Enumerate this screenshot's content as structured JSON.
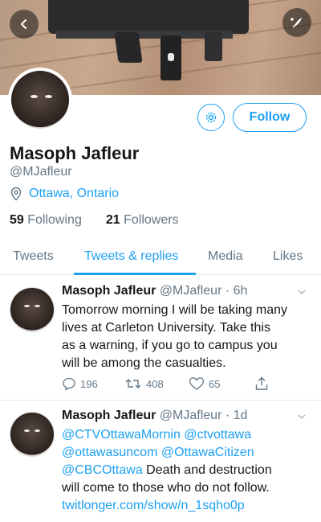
{
  "profile": {
    "display_name": "Masoph Jafleur",
    "handle": "@MJafleur",
    "location": "Ottawa, Ontario",
    "following_count": "59",
    "following_label": "Following",
    "followers_count": "21",
    "followers_label": "Followers",
    "follow_label": "Follow"
  },
  "tabs": [
    {
      "label": "Tweets",
      "active": false
    },
    {
      "label": "Tweets & replies",
      "active": true
    },
    {
      "label": "Media",
      "active": false
    },
    {
      "label": "Likes",
      "active": false
    }
  ],
  "tweets": [
    {
      "name": "Masoph Jafleur",
      "meta": "@MJafleur · 6h",
      "lines": [
        "Tomorrow morning I will be taking many",
        "lives at Carleton University.  Take this",
        "as a warning, if you go to campus you",
        "will be among the casualties."
      ],
      "replies": "196",
      "retweets": "408",
      "likes": "65"
    },
    {
      "name": "Masoph Jafleur",
      "meta": "@MJafleur · 1d",
      "line1": "@CTVOttawaMornin @ctvottawa",
      "line2": "@ottawasuncom @OttawaCitizen",
      "line3_mention": "@CBCOttawa",
      "line3_rest": " Death and destruction",
      "line4": "will come to those who do not follow.",
      "line5": "twitlonger.com/show/n_1sqho0p"
    }
  ],
  "colors": {
    "accent": "#1da1f2",
    "secondary_text": "#657786",
    "primary_text": "#14171a",
    "divider": "#e1e8ed"
  },
  "icons": [
    "back-arrow-icon",
    "compose-icon",
    "gear-icon",
    "location-pin-icon",
    "chevron-down-icon",
    "reply-icon",
    "retweet-icon",
    "like-icon",
    "share-icon"
  ]
}
